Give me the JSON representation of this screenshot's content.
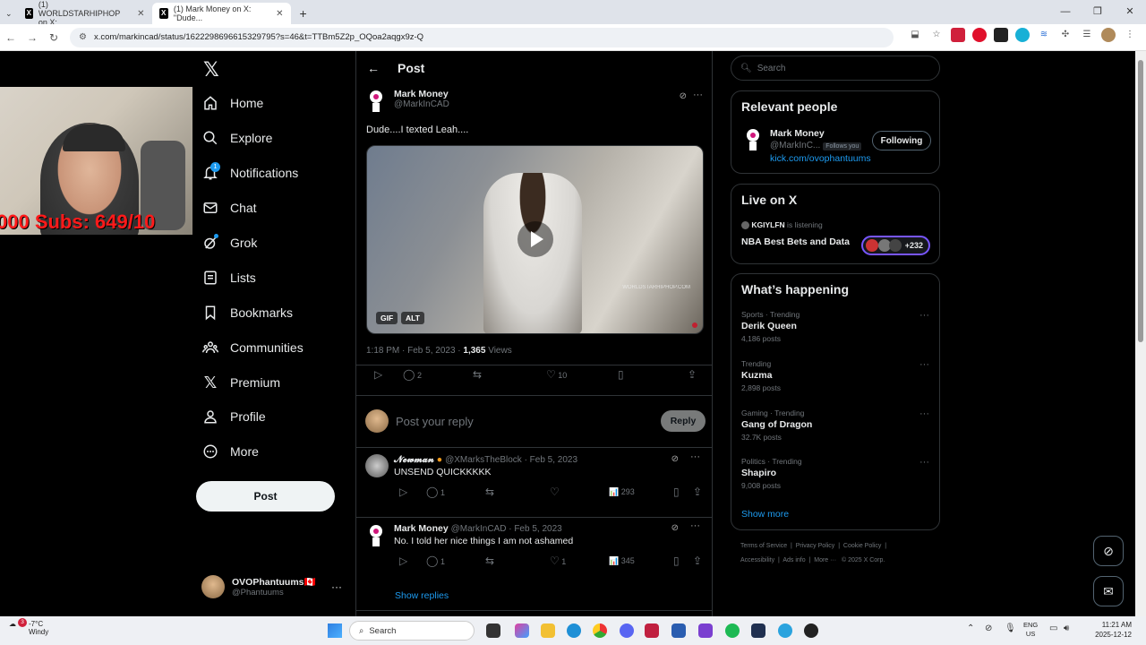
{
  "browser": {
    "tabs": [
      {
        "title": "(1) WORLDSTARHIPHOP on X: "
      },
      {
        "title": "(1) Mark Money on X: \"Dude..."
      }
    ],
    "url": "x.com/markincad/status/1622298696615329795?s=46&t=TTBm5Z2p_OQoa2aqgx9z-Q"
  },
  "webcam": {
    "overlay": "000 Subs: 649/10"
  },
  "sidebar": {
    "nav": [
      {
        "label": "Home"
      },
      {
        "label": "Explore"
      },
      {
        "label": "Notifications",
        "badge": "1"
      },
      {
        "label": "Chat"
      },
      {
        "label": "Grok"
      },
      {
        "label": "Lists"
      },
      {
        "label": "Bookmarks"
      },
      {
        "label": "Communities"
      },
      {
        "label": "Premium"
      },
      {
        "label": "Profile"
      },
      {
        "label": "More"
      }
    ],
    "post_label": "Post",
    "account": {
      "name": "OVOPhantuums🇨🇦",
      "handle": "@Phantuums"
    }
  },
  "main": {
    "header": "Post",
    "tweet": {
      "name": "Mark Money",
      "handle": "@MarkInCAD",
      "text": "Dude....I texted Leah....",
      "media": {
        "watermark": "WORLDSTARHIPHOP.COM",
        "gif": "GIF",
        "alt": "ALT"
      },
      "time": "1:18 PM · Feb 5, 2023 · ",
      "views_count": "1,365",
      "views_label": " Views",
      "replies": "2",
      "likes": "10"
    },
    "reply_placeholder": "Post your reply",
    "reply_button": "Reply",
    "replies": [
      {
        "name": "𝓝𝓮𝔀𝓶𝓪𝓷",
        "handle": "@XMarksTheBlock · Feb 5, 2023",
        "text": "UNSEND QUICKKKKK",
        "replies": "1",
        "likes": "",
        "views": "293"
      },
      {
        "name": "Mark Money",
        "handle": "@MarkInCAD · Feb 5, 2023",
        "text": "No. I told her nice things I am not ashamed",
        "replies": "1",
        "likes": "1",
        "views": "345"
      }
    ],
    "show_replies": "Show replies"
  },
  "right": {
    "search_placeholder": "Search",
    "relevant": {
      "title": "Relevant people",
      "name": "Mark Money",
      "handle": "@MarkInC...",
      "follows_you": "Follows you",
      "link": "kick.com/ovophantuums",
      "button": "Following"
    },
    "live": {
      "title": "Live on X",
      "host": "KGIYLFN",
      "status": " is listening",
      "space": "NBA Best Bets and Data",
      "count": "+232"
    },
    "happening": {
      "title": "What’s happening",
      "trends": [
        {
          "cat": "Sports · Trending",
          "title": "Derik Queen",
          "count": "4,186 posts"
        },
        {
          "cat": "Trending",
          "title": "Kuzma",
          "count": "2,898 posts"
        },
        {
          "cat": "Gaming · Trending",
          "title": "Gang of Dragon",
          "count": "32.7K posts"
        },
        {
          "cat": "Politics · Trending",
          "title": "Shapiro",
          "count": "9,008 posts"
        }
      ],
      "show_more": "Show more"
    },
    "footer": [
      "Terms of Service",
      "Privacy Policy",
      "Cookie Policy",
      "Accessibility",
      "Ads info",
      "More ···",
      "© 2025 X Corp."
    ]
  },
  "taskbar": {
    "weather_temp": "-7°C",
    "weather_desc": "Windy",
    "weather_badge": "3",
    "search": "Search",
    "lang": "ENG",
    "region": "US",
    "time": "11:21 AM",
    "date": "2025-12-12"
  },
  "colors": {
    "accent": "#1d9bf0",
    "bg": "#000000",
    "border": "#2f3336",
    "muted": "#71767b",
    "live": "#7856ff"
  }
}
